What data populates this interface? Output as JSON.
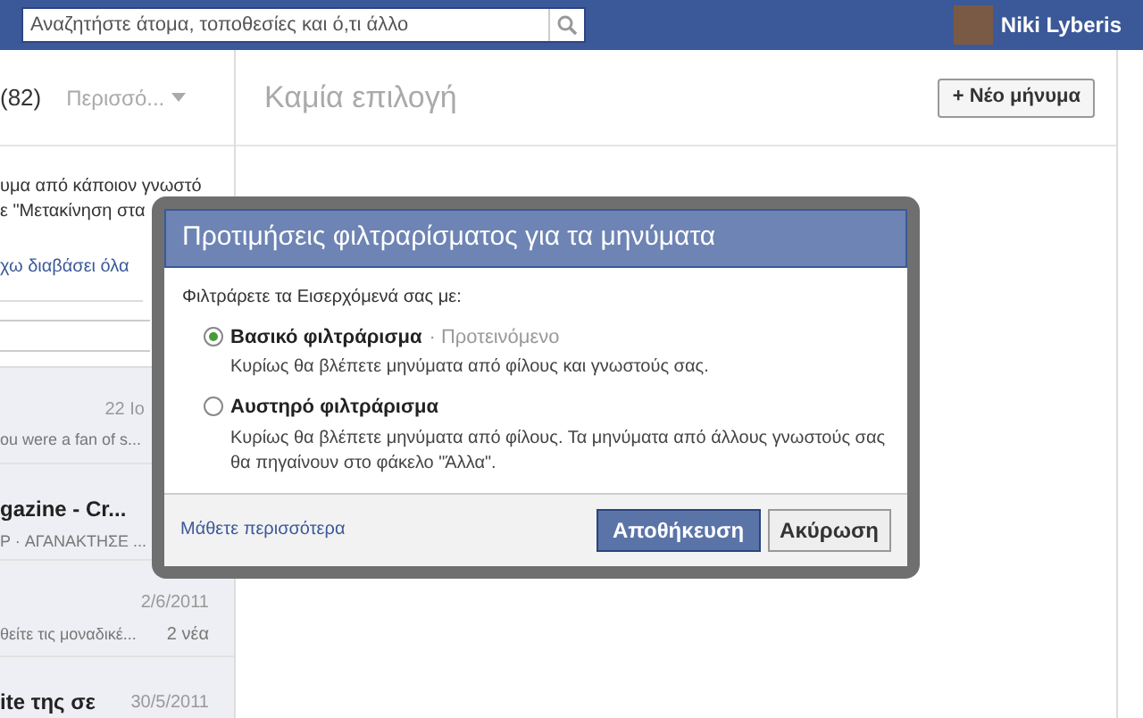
{
  "top_bar": {
    "search": {
      "placeholder": "Αναζητήστε άτομα, τοποθεσίες και ό,τι άλλο"
    },
    "user_name": "Niki Lyberis"
  },
  "left_panel": {
    "count": "(82)",
    "more_menu": "Περισσό...",
    "notice_lines": [
      "υμα από κάποιον γνωστό",
      "ε \"Μετακίνηση στα"
    ],
    "mark_read_link": "χω διαβάσει όλα",
    "threads": [
      {
        "date": "22 Ιο",
        "snippet": "ou were a fan of s..."
      },
      {
        "title": "gazine - Cr...",
        "snippet": "P · ΑΓΑΝΑΚΤΗΣΕ ..."
      },
      {
        "date": "2/6/2011",
        "snippet": "θείτε τις μοναδικέ...",
        "count": "2 νέα"
      },
      {
        "title": "ite της σε",
        "date": "30/5/2011"
      }
    ]
  },
  "main": {
    "title": "Καμία επιλογή",
    "new_message_button": "+ Νέο μήνυμα"
  },
  "dialog": {
    "title": "Προτιμήσεις φιλτραρίσματος για τα μηνύματα",
    "prompt": "Φιλτράρετε τα Εισερχόμενά σας με:",
    "options": [
      {
        "label": "Βασικό φιλτράρισμα",
        "tag": "· Προτεινόμενο",
        "description": "Κυρίως θα βλέπετε μηνύματα από φίλους και γνωστούς σας.",
        "selected": true
      },
      {
        "label": "Αυστηρό φιλτράρισμα",
        "description": "Κυρίως θα βλέπετε μηνύματα από φίλους. Τα μηνύματα από άλλους γνωστούς σας θα πηγαίνουν στο φάκελο \"Άλλα\".",
        "selected": false
      }
    ],
    "learn_more_link": "Μάθετε περισσότερα",
    "save_button": "Αποθήκευση",
    "cancel_button": "Ακύρωση"
  }
}
